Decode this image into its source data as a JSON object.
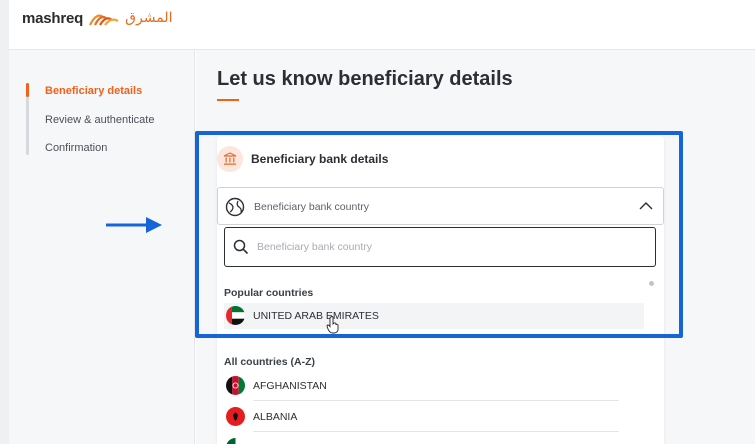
{
  "brand": {
    "name_en": "mashreq",
    "name_ar": "المشرق"
  },
  "sidebar": {
    "steps": [
      {
        "label": "Beneficiary details"
      },
      {
        "label": "Review & authenticate"
      },
      {
        "label": "Confirmation"
      }
    ]
  },
  "page": {
    "title": "Let us know beneficiary details"
  },
  "card": {
    "title": "Beneficiary bank details",
    "country_select_label": "Beneficiary bank country",
    "search_placeholder": "Beneficiary bank country"
  },
  "dropdown": {
    "popular_heading": "Popular countries",
    "popular": [
      {
        "name": "UNITED ARAB EMIRATES"
      }
    ],
    "all_heading": "All countries (A-Z)",
    "all": [
      {
        "name": "AFGHANISTAN"
      },
      {
        "name": "ALBANIA"
      }
    ]
  },
  "colors": {
    "accent": "#f0621a",
    "highlight": "#1565d8"
  },
  "icons": [
    "bank-icon",
    "globe-icon",
    "chevron-up-icon",
    "search-icon",
    "hand-cursor-icon",
    "arrow-right-icon"
  ]
}
